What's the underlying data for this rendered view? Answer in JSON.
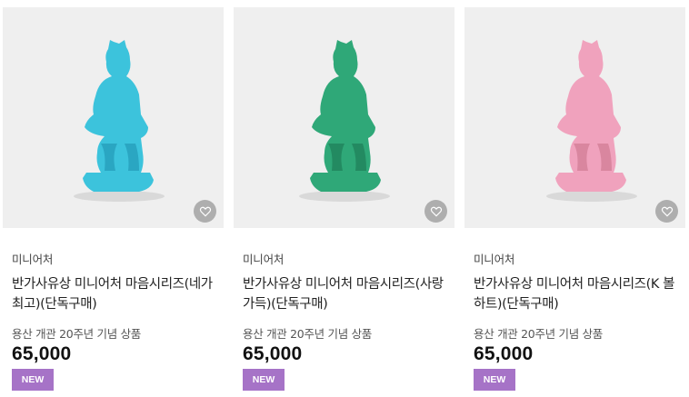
{
  "products": [
    {
      "category": "미니어처",
      "name": "반가사유상 미니어처 마음시리즈(네가 최고)(단독구매)",
      "description": "용산 개관 20주년 기념 상품",
      "price": "65,000",
      "badge": "NEW",
      "statue_color": "#3cc3dc",
      "statue_shade": "#2aa6c2",
      "wishlist_icon": "heart-outline-icon"
    },
    {
      "category": "미니어처",
      "name": "반가사유상 미니어처 마음시리즈(사랑가득)(단독구매)",
      "description": "용산 개관 20주년 기념 상품",
      "price": "65,000",
      "badge": "NEW",
      "statue_color": "#2fa878",
      "statue_shade": "#238a61",
      "wishlist_icon": "heart-outline-icon"
    },
    {
      "category": "미니어처",
      "name": "반가사유상 미니어처 마음시리즈(K 볼하트)(단독구매)",
      "description": "용산 개관 20주년 기념 상품",
      "price": "65,000",
      "badge": "NEW",
      "statue_color": "#f0a2bd",
      "statue_shade": "#d9869f",
      "wishlist_icon": "heart-outline-icon"
    }
  ],
  "colors": {
    "thumb_background": "#efefef",
    "badge_background": "#a673c7",
    "price_text": "#111111"
  }
}
